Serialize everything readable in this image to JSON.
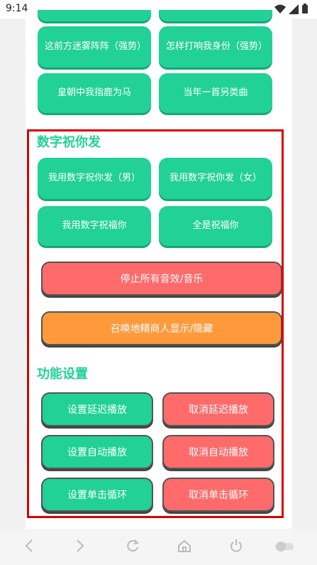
{
  "status_bar": {
    "time": "9:14"
  },
  "top_buttons": {
    "row0_left": "",
    "row0_right": "",
    "row1_left": "这前方迷雾阵阵（强势）",
    "row1_right": "怎样打响我身份（强势）",
    "row2_left": "皇朝中我指鹿为马",
    "row2_right": "当年一首另类曲"
  },
  "section_digital": {
    "title": "数字祝你发",
    "btn_male": "我用数字祝你发（男）",
    "btn_female": "我用数字祝你发（女）",
    "btn_bless": "我用数字祝福你",
    "btn_all": "全是祝福你"
  },
  "actions": {
    "stop_all": "停止所有音效/音乐",
    "summon": "召唤地精商人显示/隐藏"
  },
  "section_settings": {
    "title": "功能设置",
    "set_delay": "设置延迟播放",
    "cancel_delay": "取消延迟播放",
    "set_auto": "设置自动播放",
    "cancel_auto": "取消自动播放",
    "set_loop": "设置单击循环",
    "cancel_loop": "取消单击循环"
  },
  "colors": {
    "green": "#22d195",
    "red": "#ff6b6b",
    "orange": "#ff9a3c",
    "highlight": "#d80000"
  }
}
